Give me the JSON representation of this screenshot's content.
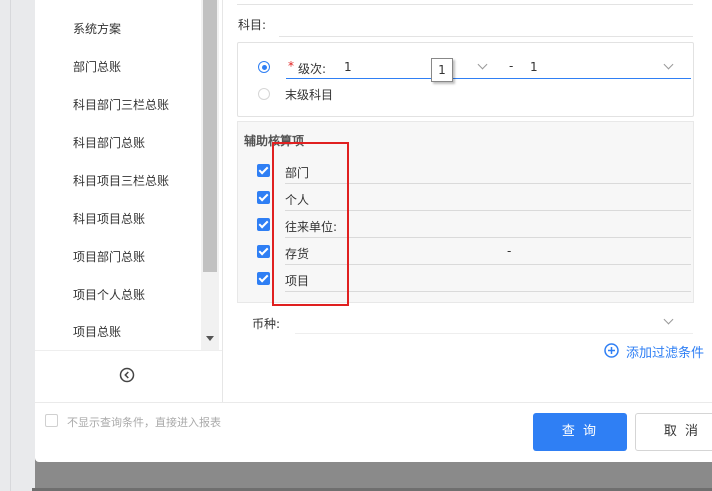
{
  "sidebar": {
    "items": [
      {
        "label": "系统方案"
      },
      {
        "label": "部门总账"
      },
      {
        "label": "科目部门三栏总账"
      },
      {
        "label": "科目部门总账"
      },
      {
        "label": "科目项目三栏总账"
      },
      {
        "label": "科目项目总账"
      },
      {
        "label": "项目部门总账"
      },
      {
        "label": "项目个人总账"
      },
      {
        "label": "项目总账"
      }
    ],
    "collapse_icon": "chevron-left-circle-icon"
  },
  "form": {
    "subject_label": "科目:",
    "level": {
      "required_mark": "*",
      "label": "级次:",
      "from_value": "1",
      "separator": "-",
      "to_value": "1",
      "tooltip": "1",
      "selected": "level"
    },
    "leaf_label": "末级科目",
    "aux": {
      "title": "辅助核算项",
      "items": [
        {
          "label": "部门",
          "checked": true,
          "value": ""
        },
        {
          "label": "个人",
          "checked": true,
          "value": ""
        },
        {
          "label": "往来单位:",
          "checked": true,
          "value": ""
        },
        {
          "label": "存货",
          "checked": true,
          "value": "-"
        },
        {
          "label": "项目",
          "checked": true,
          "value": ""
        }
      ]
    },
    "currency_label": "币种:",
    "add_filter_label": "添加过滤条件"
  },
  "footer": {
    "skip_conditions_label": "不显示查询条件，直接进入报表",
    "skip_conditions_checked": false,
    "query_button": "查 询",
    "cancel_button": "取 消"
  },
  "colors": {
    "accent": "#2f7ff4",
    "highlight_box": "#e02020"
  }
}
